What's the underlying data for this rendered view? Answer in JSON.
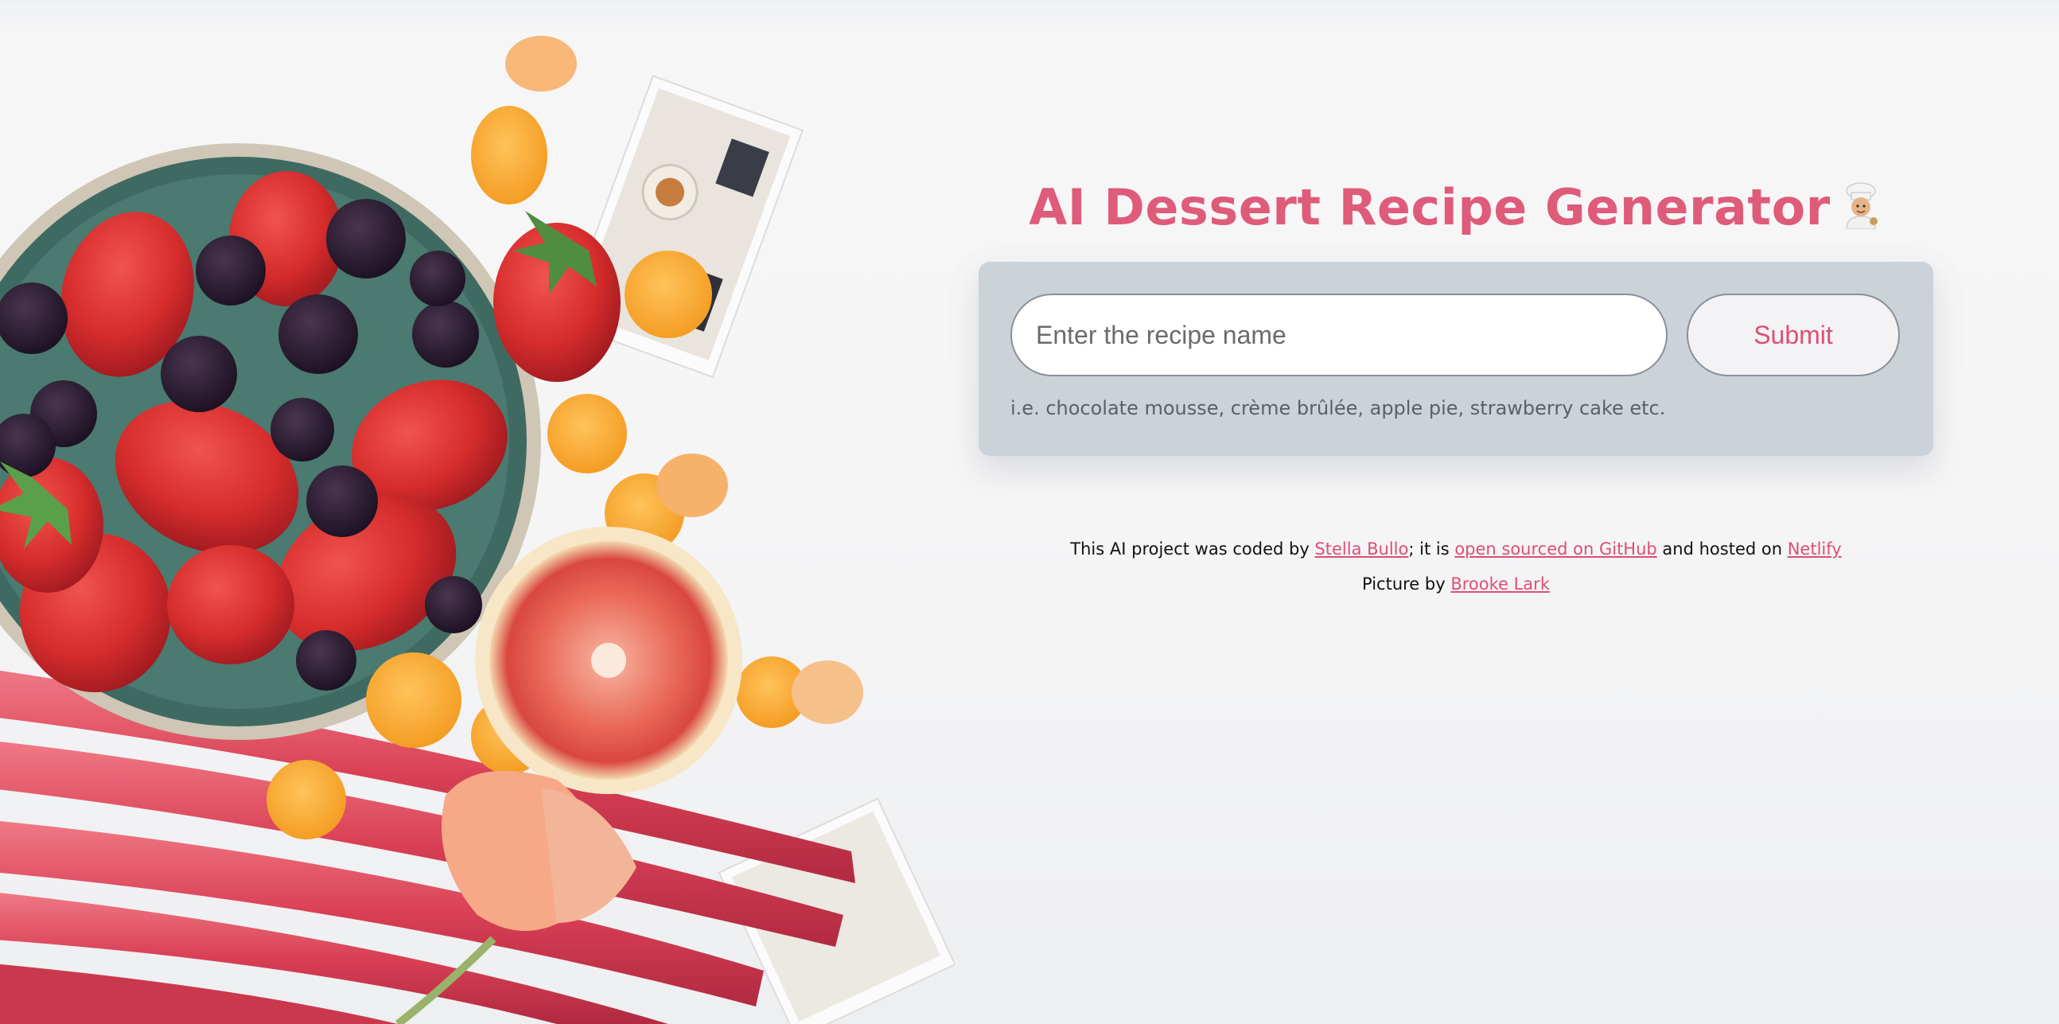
{
  "header": {
    "title": "AI Dessert Recipe Generator",
    "title_icon": "chef-icon"
  },
  "form": {
    "input_placeholder": "Enter the recipe name",
    "input_value": "",
    "submit_label": "Submit",
    "hint": "i.e. chocolate mousse, crème brûlée, apple pie, strawberry cake etc."
  },
  "footer": {
    "line1_prefix": "This AI project was coded by ",
    "author_link": "Stella Bullo",
    "line1_middle": "; it is ",
    "github_link": "open sourced on GitHub",
    "line1_connector": " and hosted on ",
    "netlify_link": "Netlify",
    "line2_prefix": "Picture by ",
    "photographer_link": "Brooke Lark"
  },
  "colors": {
    "accent": "#df5b7a",
    "card_background": "#cbd3d9",
    "page_background": "#f5f5f6"
  }
}
